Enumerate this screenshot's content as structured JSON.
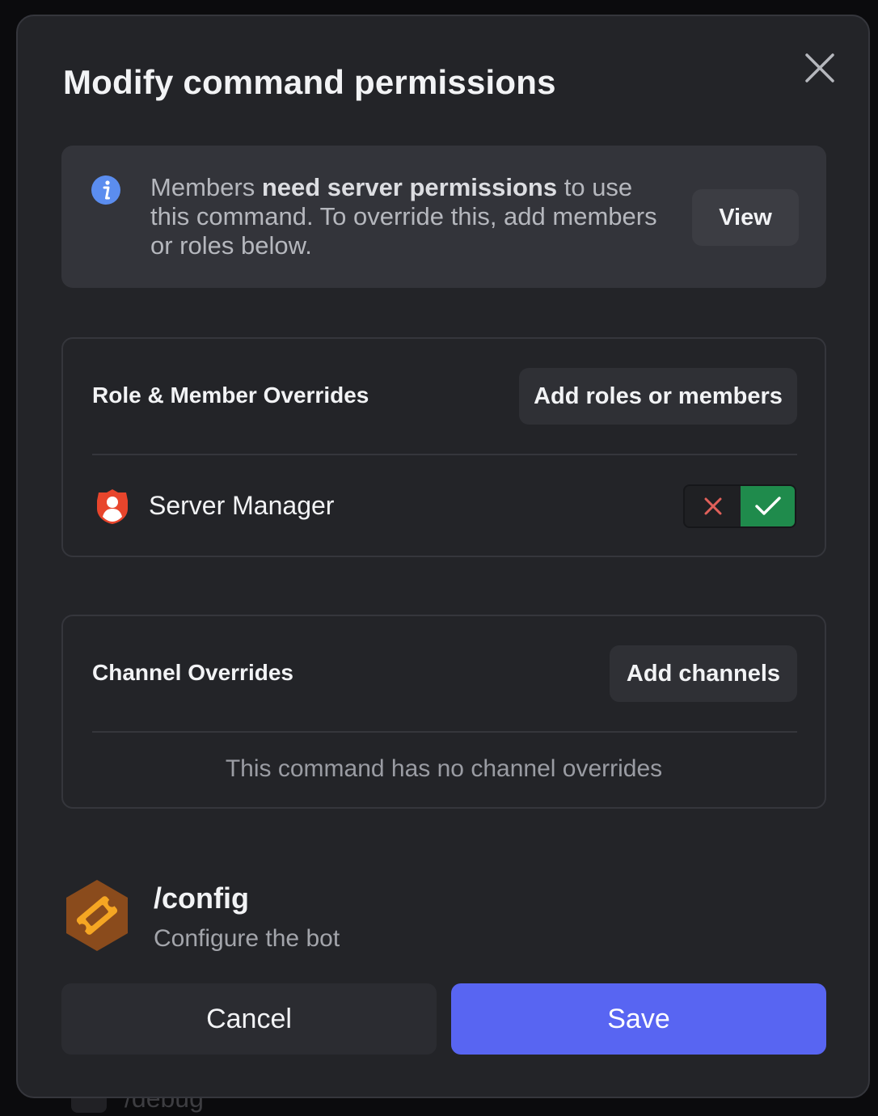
{
  "background": {
    "behind_item_label": "/debug"
  },
  "modal": {
    "title": "Modify command permissions"
  },
  "info": {
    "text_prefix": "Members ",
    "text_bold": "need server permissions",
    "text_suffix": " to use this command. To override this, add members or roles below.",
    "view_label": "View",
    "icon": "info-icon",
    "icon_color": "#5b8def"
  },
  "roles_section": {
    "title": "Role & Member Overrides",
    "add_label": "Add roles or members",
    "rows": [
      {
        "name": "Server Manager",
        "icon": "role-shield-icon",
        "icon_color": "#e8452c",
        "state": "allowed"
      }
    ]
  },
  "channels_section": {
    "title": "Channel Overrides",
    "add_label": "Add channels",
    "empty_text": "This command has no channel overrides"
  },
  "command": {
    "name": "/config",
    "description": "Configure the bot",
    "icon": "ticket-hexagon-icon"
  },
  "footer": {
    "cancel_label": "Cancel",
    "save_label": "Save"
  },
  "colors": {
    "accent": "#5865f2",
    "allow": "#1f8b4c",
    "deny": "#e0605a"
  }
}
